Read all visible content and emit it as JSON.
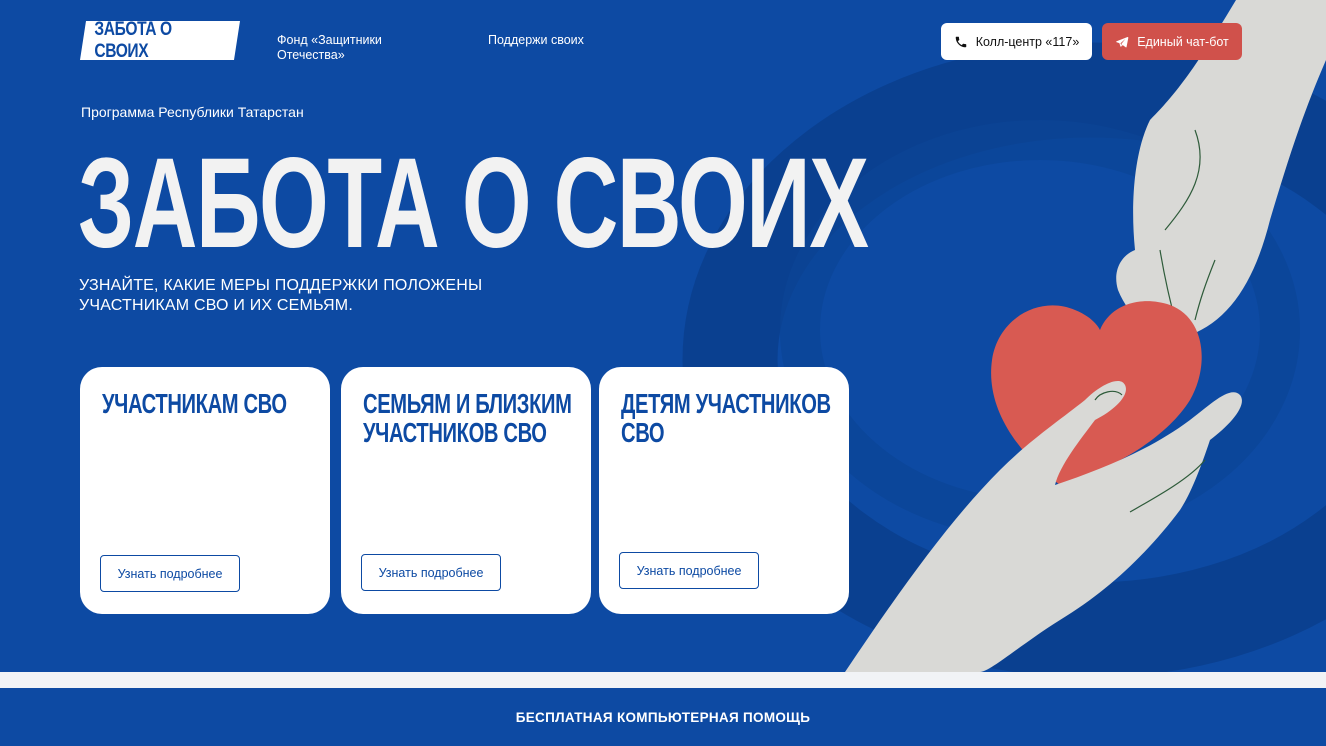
{
  "header": {
    "logo_text": "ЗАБОТА О СВОИХ",
    "nav": [
      {
        "label": "Фонд «Защитники Отечества»"
      },
      {
        "label": "Поддержи своих"
      }
    ],
    "call_button": "Колл-центр «117»",
    "chat_button": "Единый чат-бот"
  },
  "hero": {
    "program_label": "Программа Республики Татарстан",
    "title": "ЗАБОТА О СВОИХ",
    "subtitle": "Узнайте, какие меры поддержки положены участникам СВО и их семьям."
  },
  "cards": [
    {
      "title": "Участникам СВО",
      "button": "Узнать подробнее"
    },
    {
      "title": "Семьям и близким участников СВО",
      "button": "Узнать подробнее"
    },
    {
      "title": "Детям участников СВО",
      "button": "Узнать подробнее"
    }
  ],
  "footer": {
    "text": "БЕСПЛАТНАЯ КОМПЬЮТЕРНАЯ ПОМОЩЬ"
  },
  "colors": {
    "primary_blue": "#0d4aa3",
    "accent_red": "#d0514b",
    "heart_red": "#d85a52",
    "hand_gray": "#d9d9d6"
  }
}
